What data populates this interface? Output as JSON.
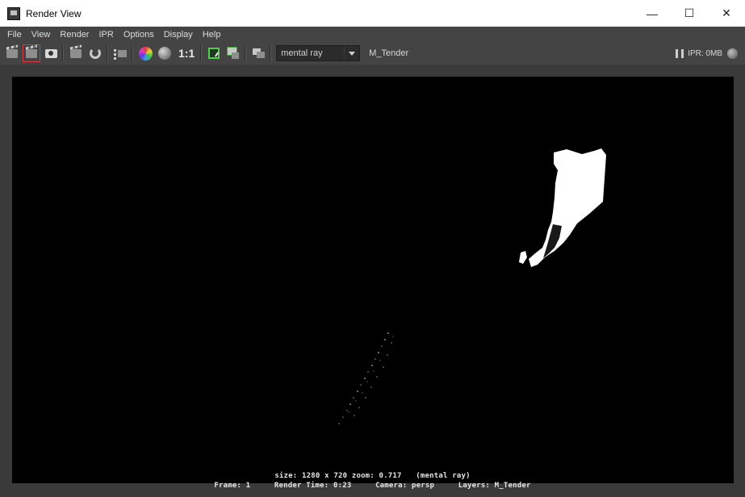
{
  "window": {
    "title": "Render View",
    "minimize": "—",
    "maximize": "☐",
    "close": "✕"
  },
  "menu": {
    "items": [
      {
        "label": "File"
      },
      {
        "label": "View"
      },
      {
        "label": "Render"
      },
      {
        "label": "IPR"
      },
      {
        "label": "Options"
      },
      {
        "label": "Display"
      },
      {
        "label": "Help"
      }
    ]
  },
  "toolbar": {
    "one_to_one": "1:1",
    "renderer": "mental ray",
    "render_layer": "M_Tender",
    "ipr_status": "IPR: 0MB"
  },
  "status": {
    "size": "size: 1280 x 720 zoom: 0.717",
    "renderer": "(mental ray)",
    "frame": "Frame: 1",
    "render_time": "Render Time: 0:23",
    "camera": "Camera: persp",
    "layers": "Layers: M_Tender"
  },
  "colors": {
    "background": "#444444",
    "render_background": "#000000",
    "accent_red": "#d23a3a",
    "accent_green": "#57c957"
  }
}
